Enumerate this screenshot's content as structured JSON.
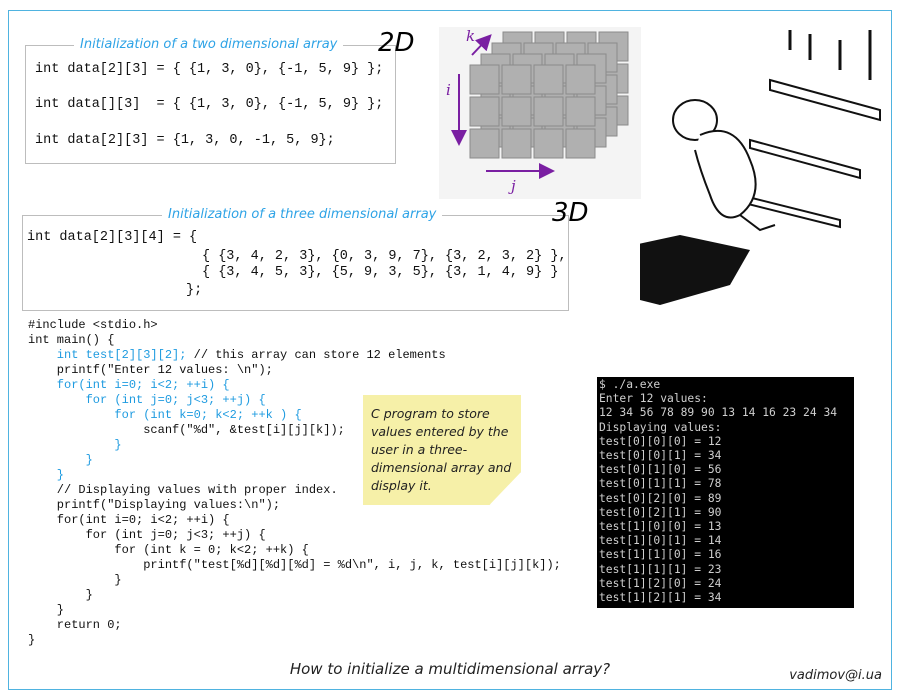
{
  "two_d": {
    "title": "Initialization of a two dimensional array",
    "badge": "2D",
    "lines": [
      "int data[2][3] = { {1, 3, 0}, {-1, 5, 9} };",
      "int data[][3]  = { {1, 3, 0}, {-1, 5, 9} };",
      "int data[2][3] = {1, 3, 0, -1, 5, 9};"
    ]
  },
  "three_d": {
    "title": "Initialization of a three dimensional array",
    "badge": "3D",
    "lines": [
      "int data[2][3][4] = {",
      "{ {3, 4, 2, 3}, {0, 3, 9, 7}, {3, 2, 3, 2} },",
      "{ {3, 4, 5, 3}, {5, 9, 3, 5}, {3, 1, 4, 9} }",
      "};"
    ]
  },
  "diagram": {
    "axis_i": "i",
    "axis_j": "j",
    "axis_k": "k"
  },
  "program": [
    {
      "text": "#include <stdio.h>",
      "color": "black"
    },
    {
      "text": "int main() {",
      "color": "black"
    },
    {
      "text": "    int test[2][3][2]; ",
      "color": "blue",
      "tail": "// this array can store 12 elements"
    },
    {
      "text": "    printf(\"Enter 12 values: \\n\");",
      "color": "black"
    },
    {
      "text": "    for(int i=0; i<2; ++i) {",
      "color": "blue"
    },
    {
      "text": "        for (int j=0; j<3; ++j) {",
      "color": "blue"
    },
    {
      "text": "            for (int k=0; k<2; ++k ) {",
      "color": "blue"
    },
    {
      "text": "                scanf(\"%d\", &test[i][j][k]);",
      "color": "black"
    },
    {
      "text": "            }",
      "color": "blue"
    },
    {
      "text": "        }",
      "color": "blue"
    },
    {
      "text": "    }",
      "color": "blue"
    },
    {
      "text": "    // Displaying values with proper index.",
      "color": "black"
    },
    {
      "text": "    printf(\"Displaying values:\\n\");",
      "color": "black"
    },
    {
      "text": "    for(int i=0; i<2; ++i) {",
      "color": "black"
    },
    {
      "text": "        for (int j=0; j<3; ++j) {",
      "color": "black"
    },
    {
      "text": "            for (int k = 0; k<2; ++k) {",
      "color": "black"
    },
    {
      "text": "                printf(\"test[%d][%d][%d] = %d\\n\", i, j, k, test[i][j][k]);",
      "color": "black"
    },
    {
      "text": "            }",
      "color": "black"
    },
    {
      "text": "        }",
      "color": "black"
    },
    {
      "text": "    }",
      "color": "black"
    },
    {
      "text": "    return 0;",
      "color": "black"
    },
    {
      "text": "}",
      "color": "black"
    }
  ],
  "note": "C program to store values entered by the user in a three-dimensional array and display it.",
  "terminal": [
    "$ ./a.exe",
    "Enter 12 values:",
    "12 34 56 78 89 90 13 14 16 23 24 34",
    "Displaying values:",
    "test[0][0][0] = 12",
    "test[0][0][1] = 34",
    "test[0][1][0] = 56",
    "test[0][1][1] = 78",
    "test[0][2][0] = 89",
    "test[0][2][1] = 90",
    "test[1][0][0] = 13",
    "test[1][0][1] = 14",
    "test[1][1][0] = 16",
    "test[1][1][1] = 23",
    "test[1][2][0] = 24",
    "test[1][2][1] = 34"
  ],
  "caption": "How to initialize a multidimensional array?",
  "email": "vadimov@i.ua",
  "colors": {
    "accent": "#2ea3e6",
    "code_blue": "#1e9be0",
    "arrow": "#7a1fa2",
    "note": "#f6f0a8"
  }
}
